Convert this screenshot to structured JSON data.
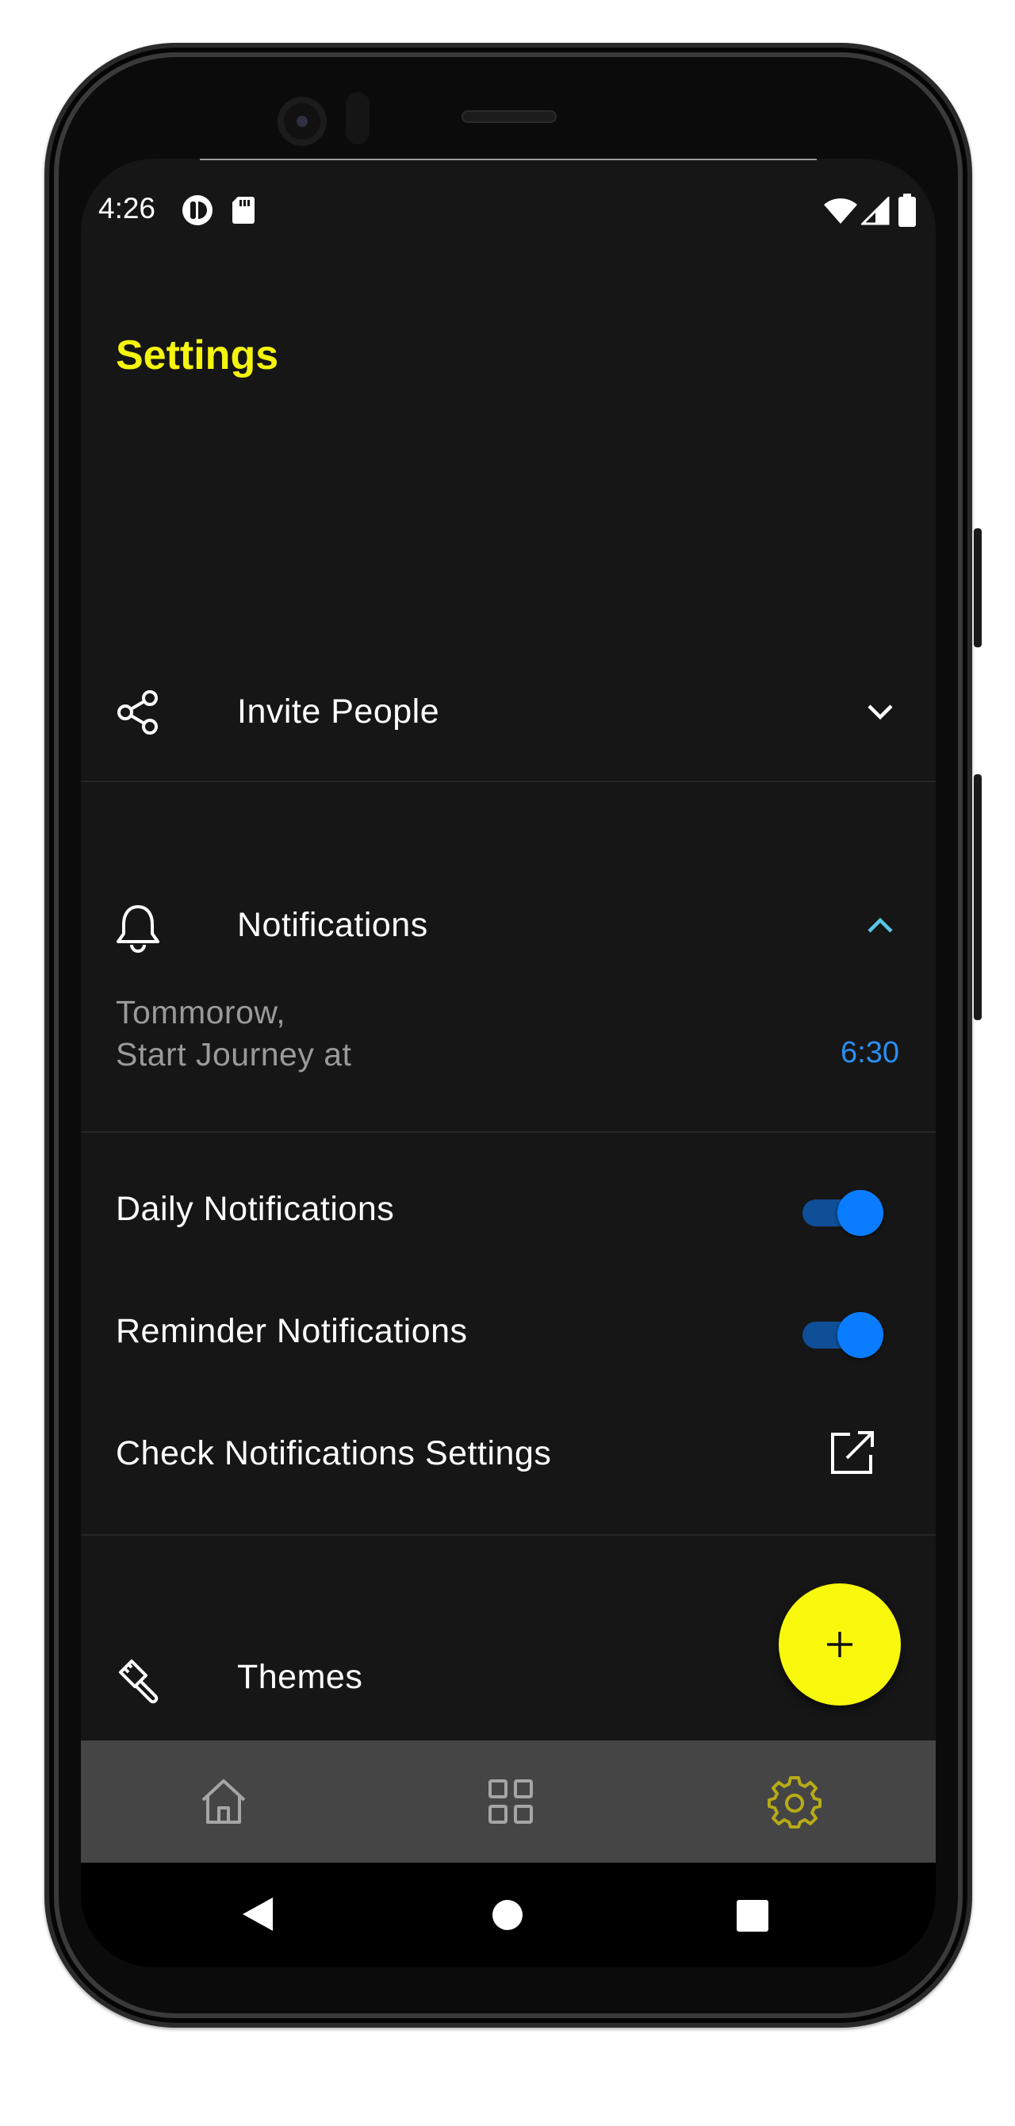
{
  "status_bar": {
    "time": "4:26"
  },
  "page": {
    "title": "Settings"
  },
  "sections": {
    "invite": {
      "label": "Invite People"
    },
    "notifications": {
      "label": "Notifications",
      "schedule_line1": "Tommorow,",
      "schedule_line2": "Start Journey at",
      "schedule_time": "6:30",
      "items": {
        "daily": {
          "label": "Daily Notifications",
          "enabled": true
        },
        "reminder": {
          "label": "Reminder Notifications",
          "enabled": true
        },
        "check": {
          "label": "Check Notifications Settings"
        }
      }
    },
    "themes": {
      "label": "Themes"
    }
  },
  "colors": {
    "accent_yellow": "#f5f50e",
    "fab_yellow": "#f8f80d",
    "toggle_on": "#0a7cff",
    "time_blue": "#2b8ff0",
    "chevron_up": "#57c7e8",
    "settings_active": "#b7ab18",
    "background": "#161616"
  },
  "icons": {
    "invite": "share-icon",
    "notifications": "bell-icon",
    "themes": "paint-brush-icon",
    "external": "external-link-icon",
    "social": "instagram-icon",
    "fab": "plus-icon",
    "nav": [
      "home-icon",
      "grid-icon",
      "gear-icon"
    ]
  },
  "bottom_nav": {
    "active": "settings"
  }
}
